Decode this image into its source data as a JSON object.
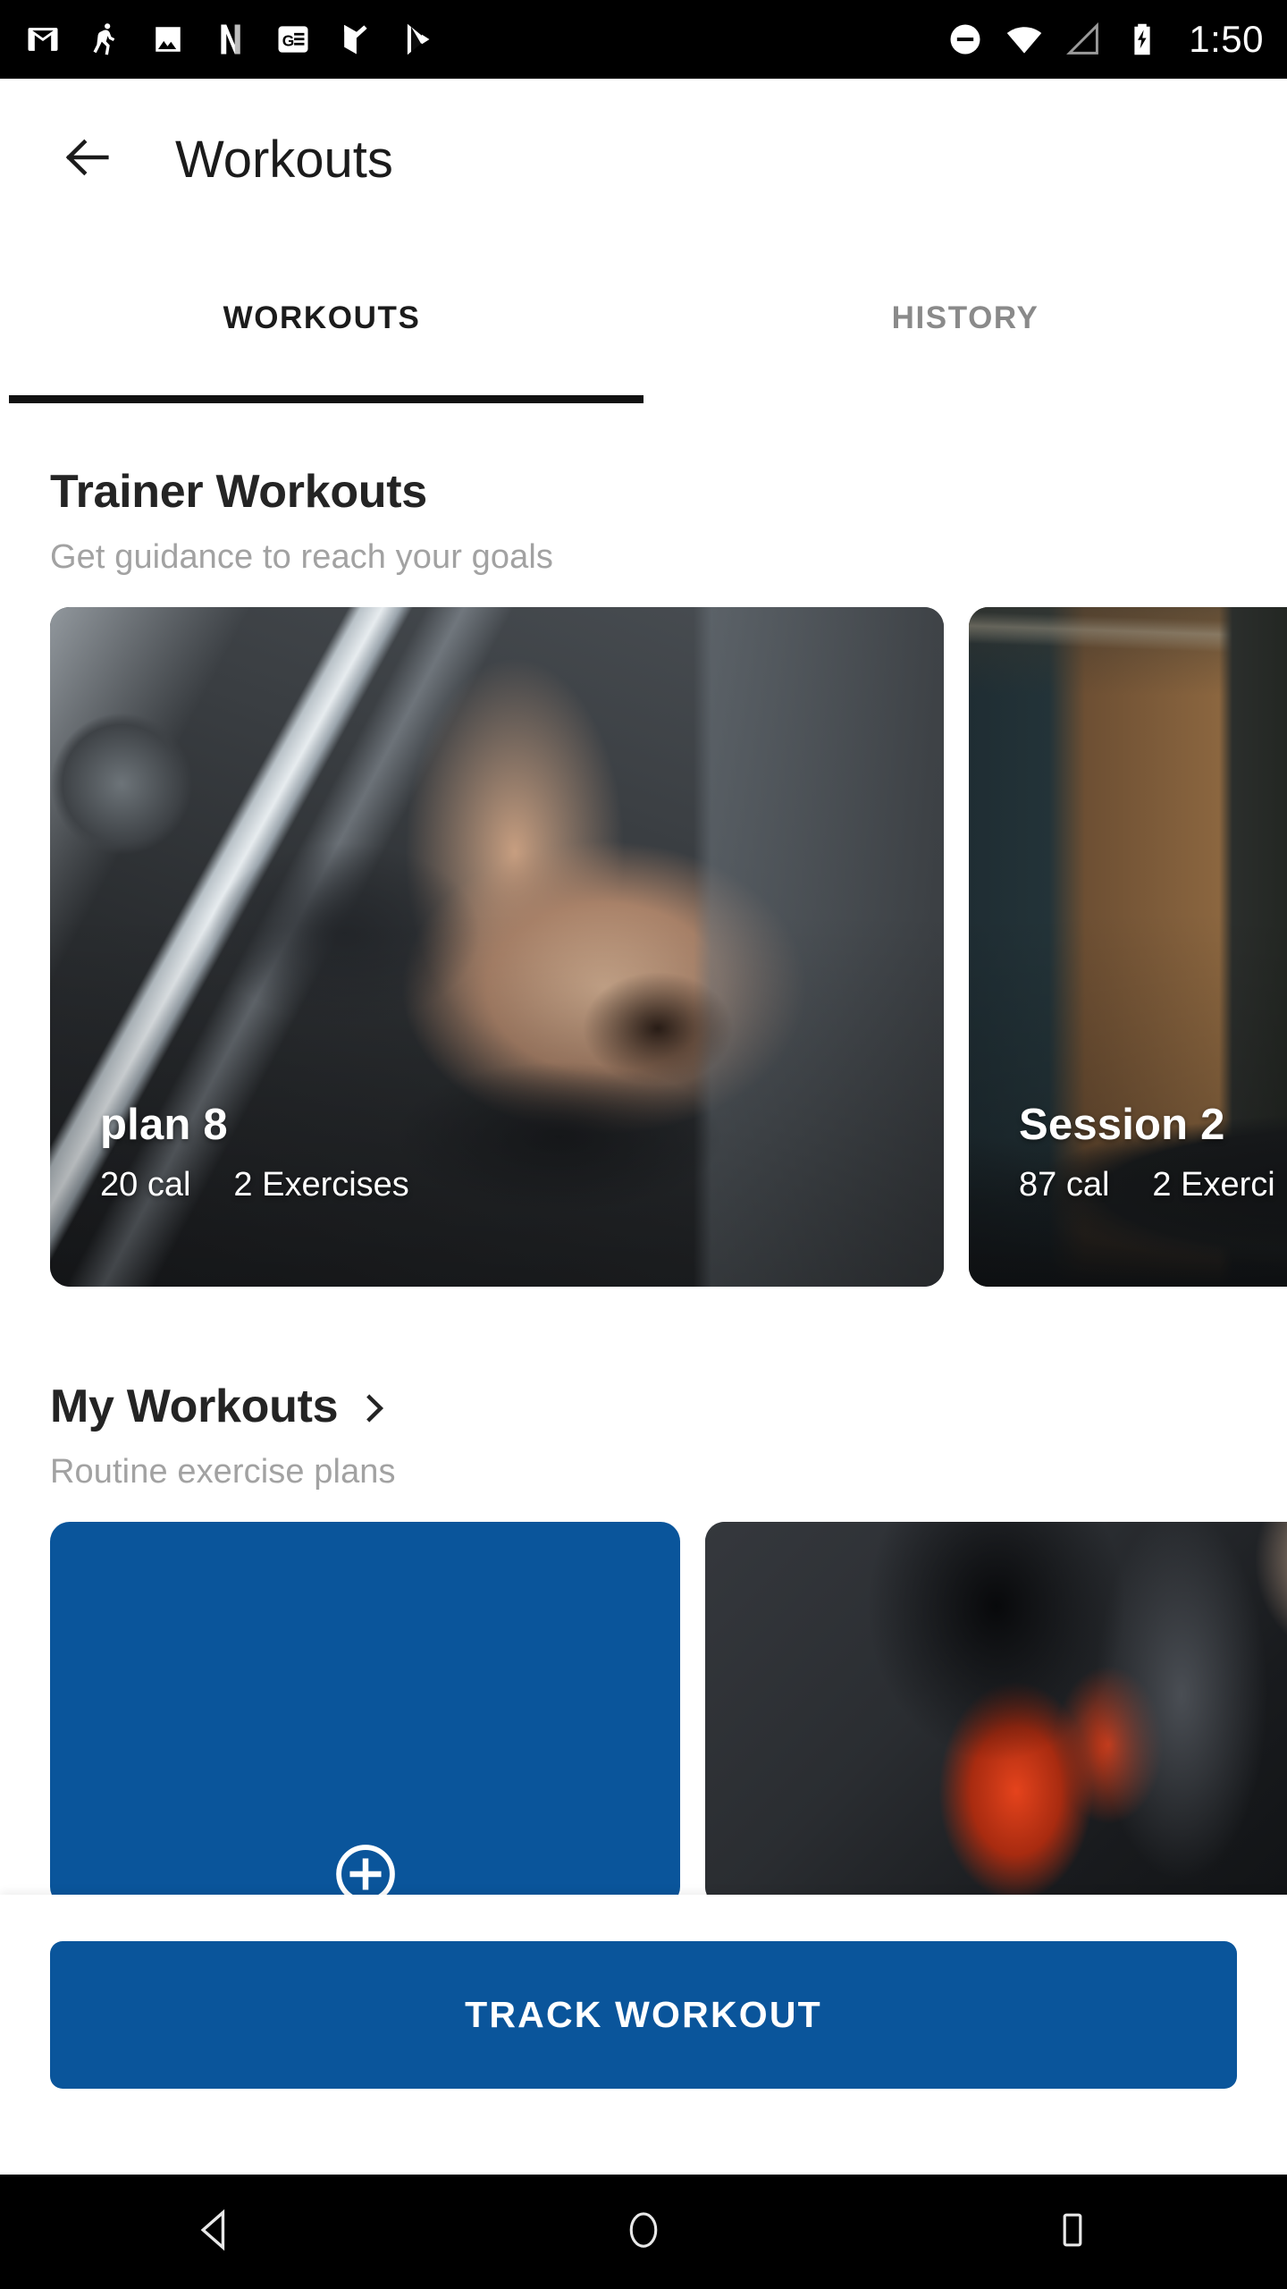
{
  "status_bar": {
    "time": "1:50",
    "notification_icons": [
      "gmail-icon",
      "fitness-person-icon",
      "photos-icon",
      "netflix-icon",
      "google-news-icon",
      "tasks-check-icon",
      "play-store-icon"
    ],
    "system_icons": [
      "do-not-disturb-icon",
      "wifi-icon",
      "cellular-signal-icon",
      "battery-charging-icon"
    ],
    "background_color": "#000000"
  },
  "app_bar": {
    "back_icon": "arrow-left-icon",
    "title": "Workouts"
  },
  "tabs": {
    "items": [
      {
        "label": "WORKOUTS",
        "active": true
      },
      {
        "label": "HISTORY",
        "active": false
      }
    ],
    "indicator_color": "#111111",
    "active_color": "#1b1b1b",
    "inactive_color": "#8a8a8a"
  },
  "sections": [
    {
      "title": "Trainer Workouts",
      "subtitle": "Get guidance to reach your goals",
      "has_chevron": false,
      "cards": [
        {
          "title": "plan 8",
          "calories": "20 cal",
          "exercises": "2 Exercises",
          "photo": "bench-press-photo"
        },
        {
          "title": "Session 2",
          "calories": "87 cal",
          "exercises": "2 Exerci",
          "photo": "barbell-rack-photo"
        }
      ]
    },
    {
      "title": "My Workouts",
      "subtitle": "Routine exercise plans",
      "has_chevron": true,
      "chevron_icon": "chevron-right-icon",
      "cards": [
        {
          "title": "",
          "calories": "",
          "exercises": "",
          "photo": "add-new-card",
          "add_icon": "plus-circle-icon"
        },
        {
          "title": "",
          "calories": "",
          "exercises": "",
          "photo": "dumbbell-photo"
        }
      ]
    }
  ],
  "bottom_sheet": {
    "track_label": "TRACK WORKOUT",
    "accent_color": "#0a559b"
  },
  "nav_bar": {
    "back_icon": "nav-back-triangle-icon",
    "home_icon": "nav-home-circle-icon",
    "recents_icon": "nav-recents-square-icon",
    "background_color": "#000000"
  }
}
